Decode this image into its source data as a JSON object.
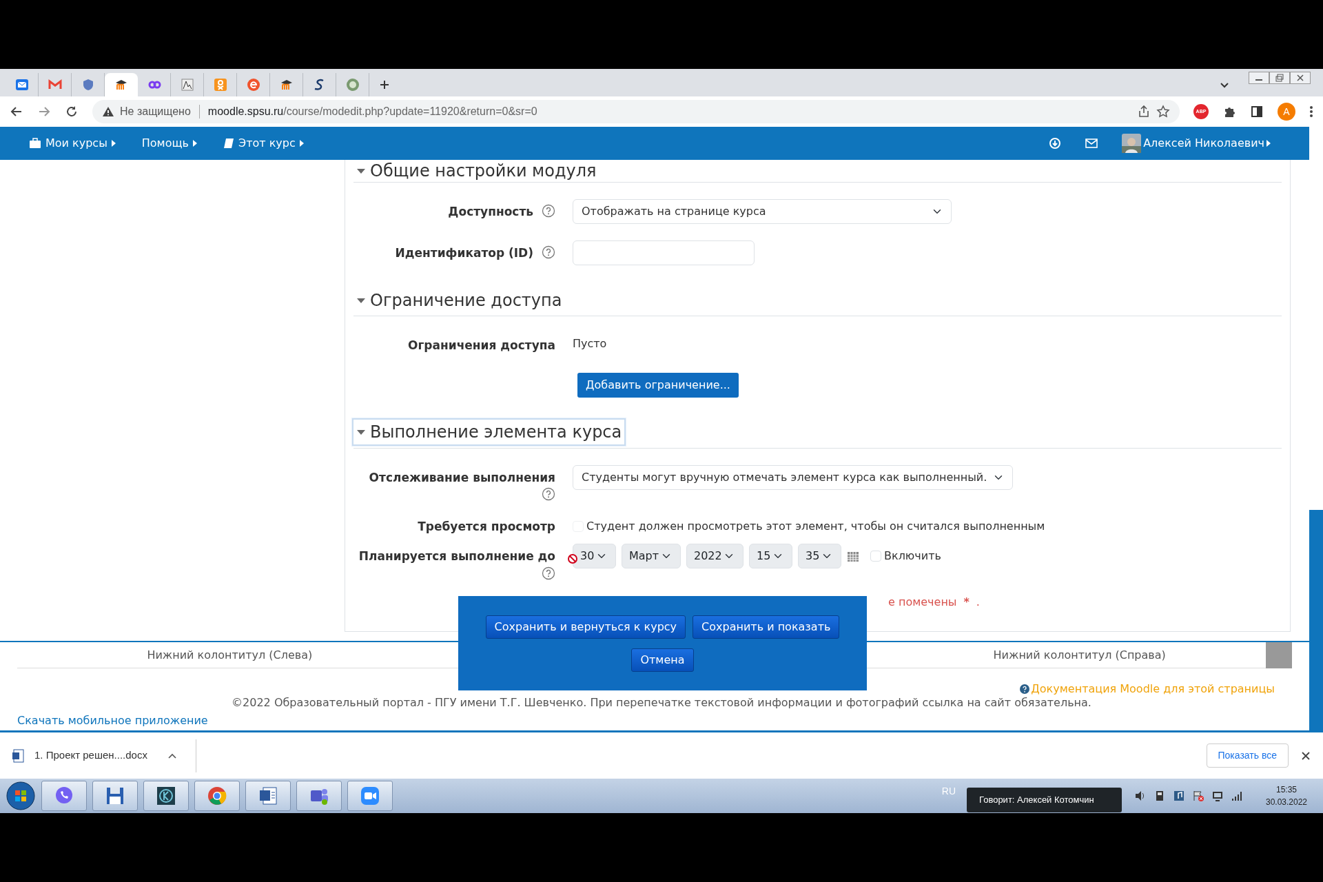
{
  "browser": {
    "tabs": [
      {
        "kind": "mail",
        "selected": false
      },
      {
        "kind": "gmail",
        "selected": false
      },
      {
        "kind": "shield",
        "selected": false
      },
      {
        "kind": "moodle",
        "selected": true
      },
      {
        "kind": "yo",
        "selected": false
      },
      {
        "kind": "font",
        "selected": false
      },
      {
        "kind": "ok",
        "selected": false
      },
      {
        "kind": "e",
        "selected": false
      },
      {
        "kind": "moodle",
        "selected": false
      },
      {
        "kind": "s",
        "selected": false
      },
      {
        "kind": "globe",
        "selected": false
      }
    ],
    "security": "Не защищено",
    "url_host": "moodle.spsu.ru",
    "url_path": "/course/modedit.php?update=11920&return=0&sr=0",
    "extension": "ABP",
    "profile": "A"
  },
  "navbar": {
    "items": [
      {
        "label": "Мои курсы"
      },
      {
        "label": "Помощь"
      },
      {
        "label": "Этот курс"
      }
    ],
    "user": "Алексей Николаевич"
  },
  "sections": [
    {
      "title": "Общие настройки модуля",
      "expanded": true,
      "focused": false,
      "fields": [
        {
          "kind": "select",
          "label": "Доступность",
          "help": true,
          "value": "Отображать на странице курса"
        },
        {
          "kind": "text",
          "label": "Идентификатор (ID)",
          "help": true
        }
      ]
    },
    {
      "title": "Ограничение доступа",
      "expanded": true,
      "focused": false,
      "fields": [
        {
          "kind": "static",
          "label": "Ограничения доступа",
          "value": "Пусто"
        },
        {
          "kind": "button",
          "label": "Добавить ограничение..."
        }
      ]
    },
    {
      "title": "Выполнение элемента курса",
      "expanded": true,
      "focused": true,
      "fields": [
        {
          "kind": "select",
          "label": "Отслеживание выполнения",
          "help": true,
          "value": "Студенты могут вручную отмечать элемент курса как выполненный."
        },
        {
          "kind": "checkbox",
          "label": "Требуется просмотр",
          "checked": false,
          "disabled": true,
          "text": "Студент должен просмотреть этот элемент, чтобы он считался выполненным"
        },
        {
          "kind": "date",
          "label": "Планируется выполнение до",
          "help": true,
          "disabled": true,
          "parts": [
            "30",
            "Март",
            "2022",
            "15",
            "35"
          ],
          "enable_label": "Включить",
          "enabled": false
        }
      ]
    }
  ],
  "required_note": {
    "text": "е помечены",
    "mark": "*",
    "end": "."
  },
  "dialog": {
    "buttons": [
      "Сохранить и вернуться к курсу",
      "Сохранить и показать"
    ],
    "cancel": "Отмена"
  },
  "footer": {
    "left": "Нижний колонтитул (Слева)",
    "right": "Нижний колонтитул (Справа)",
    "docs": "Документация Moodle для этой страницы",
    "copyright": "©2022 Образовательный портал - ПГУ имени Т.Г. Шевченко. При перепечатке текстовой информации и фотографий ссылка на сайт обязательна.",
    "app_link": "Скачать мобильное приложение"
  },
  "downloads": {
    "file": "1. Проект решен....docx",
    "show_all": "Показать все"
  },
  "taskbar": {
    "apps": [
      {
        "kind": "viber"
      },
      {
        "kind": "floppy"
      },
      {
        "kind": "kapp"
      },
      {
        "kind": "chrome"
      },
      {
        "kind": "word"
      },
      {
        "kind": "teams"
      },
      {
        "kind": "zoom"
      }
    ],
    "lang": "RU",
    "tooltip": "Говорит: Алексей Котомчин",
    "time": "15:35",
    "date": "30.03.2022"
  }
}
